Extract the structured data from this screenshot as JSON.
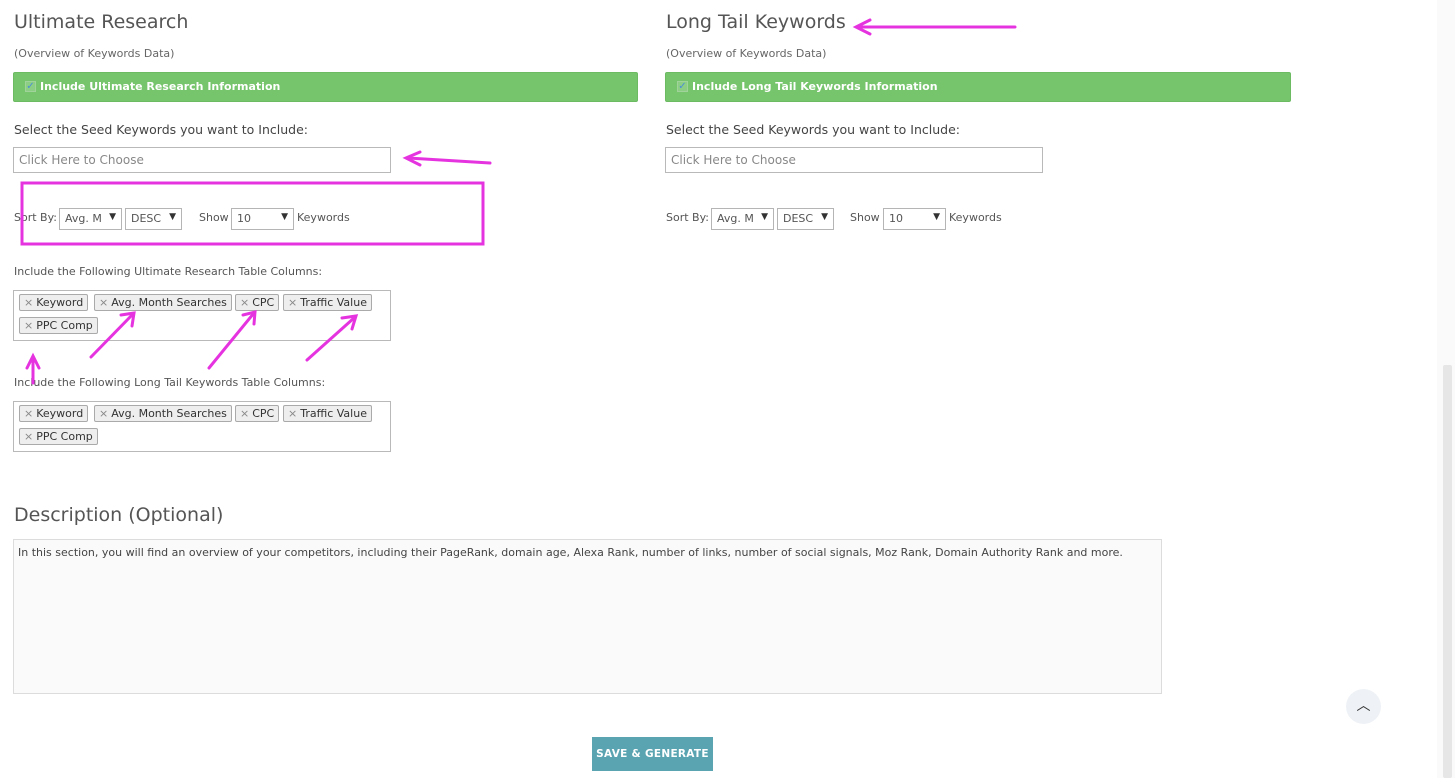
{
  "left": {
    "title": "Ultimate Research",
    "subtitle": "(Overview of Keywords Data)",
    "include_label": "Include Ultimate Research Information",
    "seed_label": "Select the Seed Keywords you want to Include:",
    "seed_placeholder": "Click Here to Choose",
    "sort_by_label": "Sort By:",
    "sort_field": "Avg. M",
    "sort_order": "DESC",
    "show_label": "Show",
    "show_count": "10",
    "keywords_label": "Keywords",
    "columns_label": "Include the Following Ultimate Research Table Columns:",
    "columns": [
      "Keyword",
      "Avg. Month Searches",
      "CPC",
      "Traffic Value",
      "PPC Comp"
    ],
    "lt_columns_label": "Include the Following Long Tail Keywords Table Columns:",
    "lt_columns": [
      "Keyword",
      "Avg. Month Searches",
      "CPC",
      "Traffic Value",
      "PPC Comp"
    ]
  },
  "right": {
    "title": "Long Tail Keywords",
    "subtitle": "(Overview of Keywords Data)",
    "include_label": "Include Long Tail Keywords Information",
    "seed_label": "Select the Seed Keywords you want to Include:",
    "seed_placeholder": "Click Here to Choose",
    "sort_by_label": "Sort By:",
    "sort_field": "Avg. M",
    "sort_order": "DESC",
    "show_label": "Show",
    "show_count": "10",
    "keywords_label": "Keywords"
  },
  "description": {
    "title": "Description (Optional)",
    "text": "In this section, you will find an overview of your competitors, including their PageRank, domain age, Alexa Rank, number of links, number of social signals, Moz Rank, Domain Authority Rank and more."
  },
  "save_button": "SAVE & GENERATE",
  "icons": {
    "checkbox": "checkbox-checked-icon",
    "remove": "remove-x-icon",
    "dropdown": "caret-down-icon",
    "scroll_up": "chevron-up-icon"
  },
  "colors": {
    "green": "#76c46b",
    "button": "#5aa4b2",
    "annotation": "#e633e0"
  }
}
